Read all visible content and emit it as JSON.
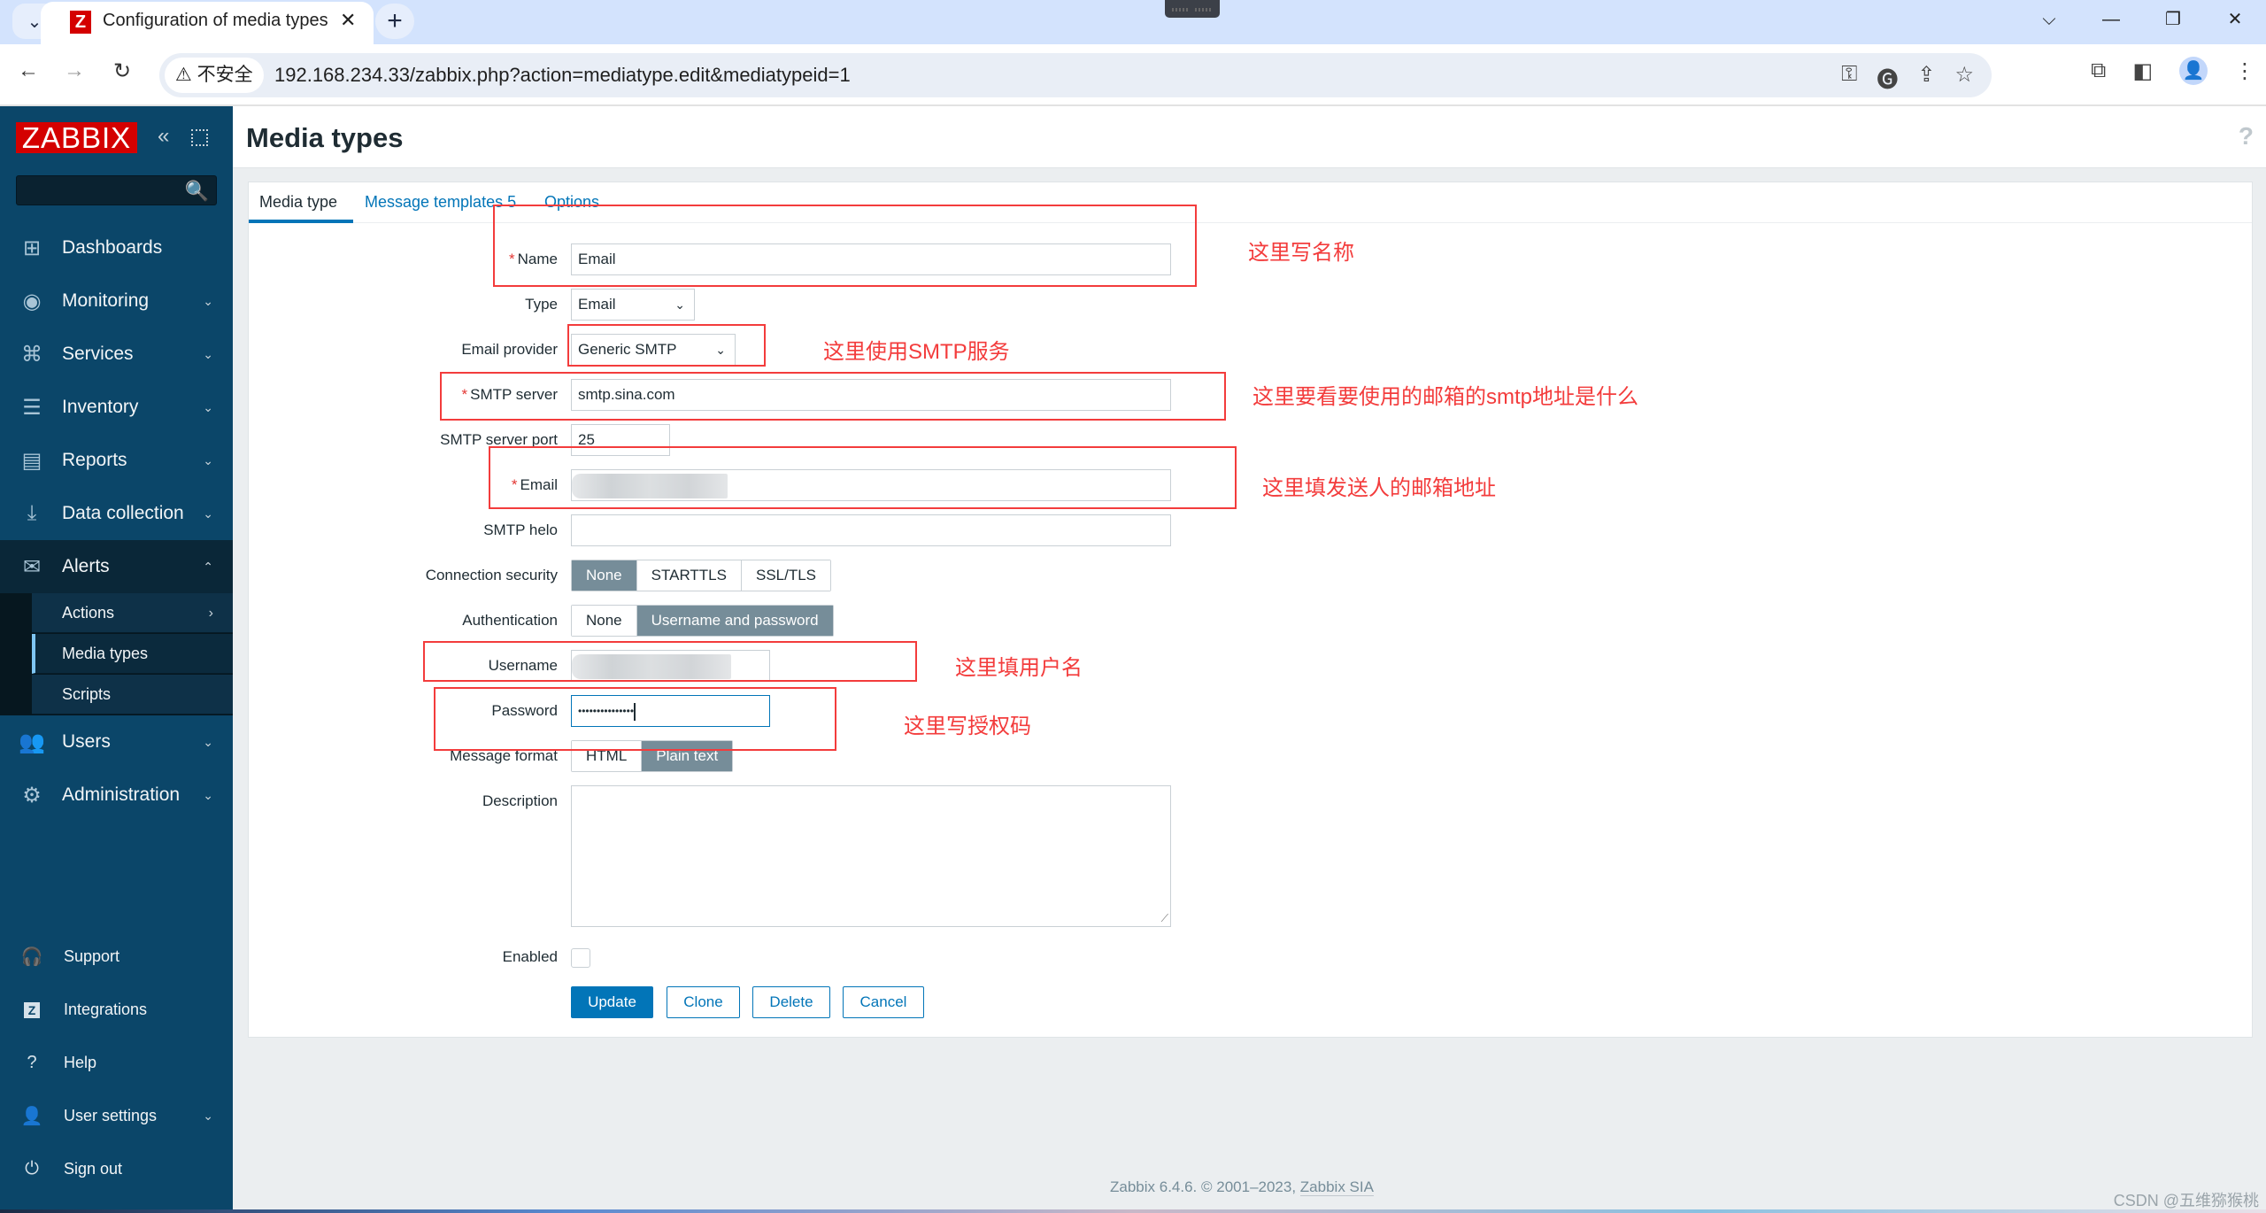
{
  "browser": {
    "tab_title": "Configuration of media types",
    "tab_favicon": "Z",
    "tab_close": "✕",
    "new_tab": "+",
    "tab_menu": "⌄",
    "security_label": "⚠ 不安全",
    "url": "192.168.234.33/zabbix.php?action=mediatype.edit&mediatypeid=1",
    "window_controls": {
      "dropdown": "⌵",
      "minimize": "—",
      "restore": "❐",
      "close": "✕"
    },
    "nav": {
      "back": "←",
      "forward": "→",
      "reload": "↻"
    },
    "omnibox_icons": {
      "key": "⚿",
      "translate": "🅖",
      "share": "⇪",
      "bookmark": "☆"
    },
    "toolbar_icons": {
      "extensions": "⧉",
      "sidepanel": "◧",
      "profile": "👤",
      "menu": "⋮"
    }
  },
  "sidebar": {
    "logo": "ZABBIX",
    "collapse_icon": "«",
    "search_placeholder": "",
    "search_icon": "🔍",
    "menu": [
      {
        "label": "Dashboards",
        "icon": "⊞",
        "chevron": ""
      },
      {
        "label": "Monitoring",
        "icon": "◉",
        "chevron": "⌄"
      },
      {
        "label": "Services",
        "icon": "⌘",
        "chevron": "⌄"
      },
      {
        "label": "Inventory",
        "icon": "☰",
        "chevron": "⌄"
      },
      {
        "label": "Reports",
        "icon": "▤",
        "chevron": "⌄"
      },
      {
        "label": "Data collection",
        "icon": "⤓",
        "chevron": "⌄"
      },
      {
        "label": "Alerts",
        "icon": "✉",
        "chevron": "⌃"
      },
      {
        "label": "Users",
        "icon": "👥",
        "chevron": "⌄"
      },
      {
        "label": "Administration",
        "icon": "⚙",
        "chevron": "⌄"
      }
    ],
    "alerts_submenu": [
      {
        "label": "Actions",
        "chevron": "›"
      },
      {
        "label": "Media types",
        "chevron": ""
      },
      {
        "label": "Scripts",
        "chevron": ""
      }
    ],
    "bottom": [
      {
        "label": "Support",
        "icon": "🎧",
        "chevron": ""
      },
      {
        "label": "Integrations",
        "icon": "Z",
        "chevron": ""
      },
      {
        "label": "Help",
        "icon": "?",
        "chevron": ""
      },
      {
        "label": "User settings",
        "icon": "👤",
        "chevron": "⌄"
      },
      {
        "label": "Sign out",
        "icon": "⏻",
        "chevron": ""
      }
    ]
  },
  "header": {
    "title": "Media types",
    "help": "?"
  },
  "tabs": [
    {
      "label": "Media type",
      "active": true
    },
    {
      "label": "Message templates 5",
      "active": false
    },
    {
      "label": "Options",
      "active": false
    }
  ],
  "form": {
    "name": {
      "label": "Name",
      "required": true,
      "value": "Email"
    },
    "type": {
      "label": "Type",
      "value": "Email"
    },
    "email_provider": {
      "label": "Email provider",
      "value": "Generic SMTP"
    },
    "smtp_server": {
      "label": "SMTP server",
      "required": true,
      "value": "smtp.sina.com"
    },
    "smtp_port": {
      "label": "SMTP server port",
      "value": "25"
    },
    "email": {
      "label": "Email",
      "required": true,
      "value": ""
    },
    "smtp_helo": {
      "label": "SMTP helo",
      "value": ""
    },
    "connection_security": {
      "label": "Connection security",
      "options": [
        "None",
        "STARTTLS",
        "SSL/TLS"
      ],
      "selected": "None"
    },
    "authentication": {
      "label": "Authentication",
      "options": [
        "None",
        "Username and password"
      ],
      "selected": "Username and password"
    },
    "username": {
      "label": "Username",
      "value": ""
    },
    "password": {
      "label": "Password",
      "value": "•••••••••••••••"
    },
    "message_format": {
      "label": "Message format",
      "options": [
        "HTML",
        "Plain text"
      ],
      "selected": "Plain text"
    },
    "description": {
      "label": "Description",
      "value": ""
    },
    "enabled": {
      "label": "Enabled",
      "checked": false
    },
    "buttons": {
      "update": "Update",
      "clone": "Clone",
      "delete": "Delete",
      "cancel": "Cancel"
    }
  },
  "annotations": {
    "name": "这里写名称",
    "provider": "这里使用SMTP服务",
    "smtp": "这里要看要使用的邮箱的smtp地址是什么",
    "email": "这里填发送人的邮箱地址",
    "username": "这里填用户名",
    "password": "这里写授权码",
    "color": "#f33c3c"
  },
  "footer": {
    "text": "Zabbix 6.4.6. © 2001–2023, ",
    "link": "Zabbix SIA"
  },
  "watermark": "CSDN @五维猕猴桃"
}
